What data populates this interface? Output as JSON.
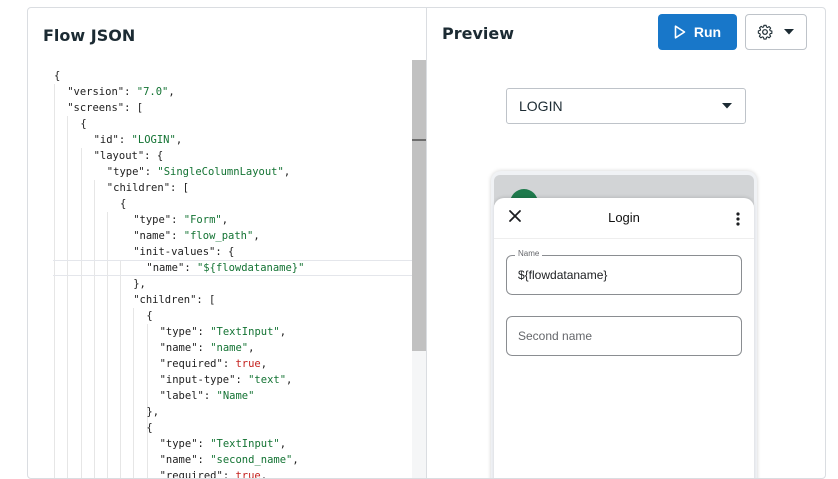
{
  "editor": {
    "title": "Flow JSON",
    "lines": [
      "{",
      "\"version\": \"7.0\",",
      "\"screens\": [",
      "{",
      "\"id\": \"LOGIN\",",
      "\"layout\": {",
      "\"type\": \"SingleColumnLayout\",",
      "\"children\": [",
      "{",
      "\"type\": \"Form\",",
      "\"name\": \"flow_path\",",
      "\"init-values\": {",
      "\"name\": \"${flowdataname}\"",
      "},",
      "\"children\": [",
      "{",
      "\"type\": \"TextInput\",",
      "\"name\": \"name\",",
      "\"required\": true,",
      "\"input-type\": \"text\",",
      "\"label\": \"Name\"",
      "},",
      "{",
      "\"type\": \"TextInput\",",
      "\"name\": \"second_name\",",
      "\"required\": true,"
    ]
  },
  "preview": {
    "title": "Preview",
    "run_label": "Run",
    "play_icon": "play-icon",
    "settings_icon": "gear-icon",
    "caret_icon": "chevron-down-icon",
    "screen_select": "LOGIN"
  },
  "phone": {
    "sheet_title": "Login",
    "close_icon": "close-icon",
    "more_icon": "more-vertical-icon",
    "fields": [
      {
        "label": "Name",
        "value": "${flowdataname}"
      },
      {
        "placeholder": "Second name"
      }
    ]
  },
  "colors": {
    "run_button": "#1877c9",
    "json_string": "#137333",
    "json_boolean": "#c5221f",
    "avatar": "#1f7a4d"
  }
}
